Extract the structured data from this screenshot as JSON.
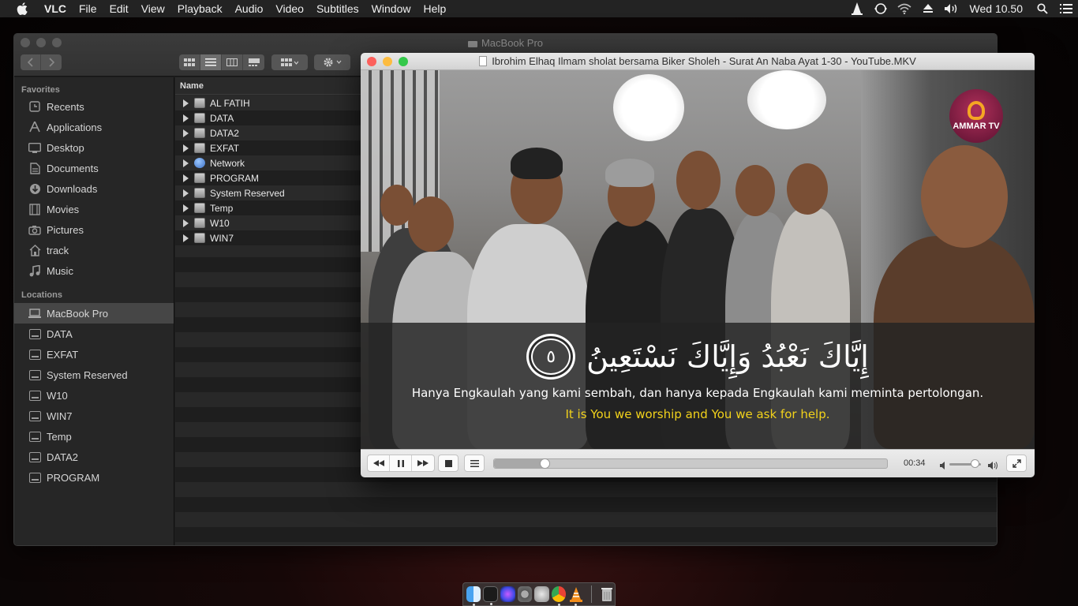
{
  "menubar": {
    "app_name": "VLC",
    "menus": [
      "File",
      "Edit",
      "View",
      "Playback",
      "Audio",
      "Video",
      "Subtitles",
      "Window",
      "Help"
    ],
    "clock": "Wed 10.50",
    "status_icons": [
      "vlc-cone-icon",
      "sync-icon",
      "wifi-icon",
      "eject-icon",
      "volume-icon",
      "search-icon",
      "list-icon"
    ]
  },
  "finder": {
    "title": "MacBook Pro",
    "sidebar": {
      "favorites_header": "Favorites",
      "favorites": [
        {
          "label": "Recents",
          "icon": "clock-icon"
        },
        {
          "label": "Applications",
          "icon": "applications-icon"
        },
        {
          "label": "Desktop",
          "icon": "desktop-icon"
        },
        {
          "label": "Documents",
          "icon": "document-icon"
        },
        {
          "label": "Downloads",
          "icon": "download-icon"
        },
        {
          "label": "Movies",
          "icon": "film-icon"
        },
        {
          "label": "Pictures",
          "icon": "camera-icon"
        },
        {
          "label": "track",
          "icon": "home-icon"
        },
        {
          "label": "Music",
          "icon": "music-note-icon"
        }
      ],
      "locations_header": "Locations",
      "locations": [
        {
          "label": "MacBook Pro",
          "selected": true
        },
        {
          "label": "DATA"
        },
        {
          "label": "EXFAT"
        },
        {
          "label": "System Reserved"
        },
        {
          "label": "W10"
        },
        {
          "label": "WIN7"
        },
        {
          "label": "Temp"
        },
        {
          "label": "DATA2"
        },
        {
          "label": "PROGRAM"
        }
      ]
    },
    "list": {
      "column_header": "Name",
      "items": [
        {
          "name": "AL FATIH",
          "icon": "drive-icon"
        },
        {
          "name": "DATA",
          "icon": "drive-icon"
        },
        {
          "name": "DATA2",
          "icon": "drive-icon"
        },
        {
          "name": "EXFAT",
          "icon": "drive-icon"
        },
        {
          "name": "Network",
          "icon": "network-globe-icon"
        },
        {
          "name": "PROGRAM",
          "icon": "drive-icon"
        },
        {
          "name": "System Reserved",
          "icon": "drive-icon"
        },
        {
          "name": "Temp",
          "icon": "drive-icon"
        },
        {
          "name": "W10",
          "icon": "drive-icon"
        },
        {
          "name": "WIN7",
          "icon": "drive-icon"
        }
      ]
    }
  },
  "vlc": {
    "title": "Ibrohim Elhaq Ilmam sholat bersama Biker Sholeh - Surat An Naba Ayat 1-30 - YouTube.MKV",
    "logo_text": "AMMAR TV",
    "subtitles": {
      "arabic": "إِيَّاكَ نَعْبُدُ وَإِيَّاكَ نَسْتَعِينُ",
      "ayah_number": "٥",
      "indonesian": "Hanya Engkaulah yang kami sembah, dan hanya kepada Engkaulah kami meminta pertolongan.",
      "english": "It is You we worship and You we ask for help."
    },
    "controls": {
      "elapsed": "00:34",
      "progress_fraction": 0.128,
      "volume_fraction": 0.8,
      "buttons": [
        "rewind-icon",
        "pause-icon",
        "fast-forward-icon",
        "stop-icon",
        "playlist-icon",
        "fullscreen-icon"
      ]
    }
  },
  "dock": {
    "apps": [
      "finder-icon",
      "terminal-icon",
      "siri-icon",
      "system-preferences-icon",
      "launchpad-icon",
      "chrome-icon",
      "vlc-icon",
      "trash-icon"
    ]
  },
  "colors": {
    "subtitle_english": "#f2d21b",
    "subtitle_indonesian": "#ffffff",
    "traffic_close": "#fc605c",
    "traffic_min": "#fdbc40",
    "traffic_max": "#34c84a"
  }
}
